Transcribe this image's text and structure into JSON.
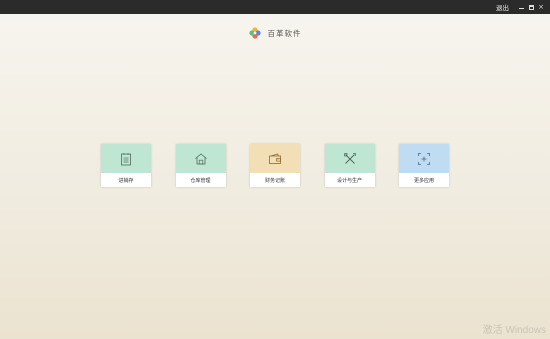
{
  "titlebar": {
    "logout_label": "退出",
    "close_glyph": "×"
  },
  "brand": {
    "name": "百革软件",
    "logo_icon": "pinwheel-logo-icon"
  },
  "apps": [
    {
      "label": "进销存",
      "icon": "clipboard-icon",
      "color": "#bfe6d3"
    },
    {
      "label": "仓库管理",
      "icon": "warehouse-icon",
      "color": "#bfe6d3"
    },
    {
      "label": "财务记账",
      "icon": "wallet-icon",
      "color": "#f3dfb6"
    },
    {
      "label": "设计与生产",
      "icon": "design-tools-icon",
      "color": "#bfe6d3"
    },
    {
      "label": "更多应用",
      "icon": "add-frame-icon",
      "color": "#bfdcf3"
    }
  ],
  "watermark": "激活 Windows"
}
